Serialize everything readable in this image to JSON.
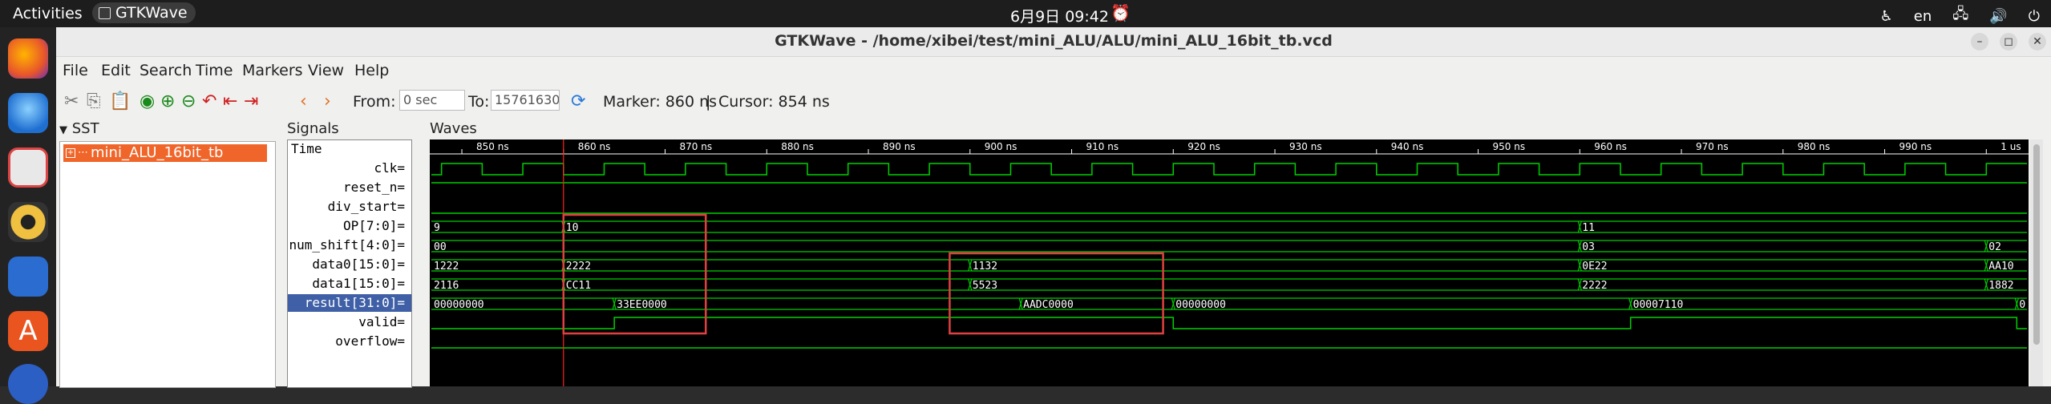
{
  "topbar": {
    "activities": "Activities",
    "app_name": "GTKWave",
    "clock": "6月9日  09:42",
    "lang": "en"
  },
  "window": {
    "title": "GTKWave - /home/xibei/test/mini_ALU/ALU/mini_ALU_16bit_tb.vcd"
  },
  "menu": [
    "File",
    "Edit",
    "Search",
    "Time",
    "Markers",
    "View",
    "Help"
  ],
  "toolbar": {
    "from_label": "From:",
    "from_value": "0 sec",
    "to_label": "To:",
    "to_value": "15761630",
    "marker_text": "Marker: 860 ns",
    "sep": "|",
    "cursor_text": "Cursor: 854 ns"
  },
  "sst": {
    "header": "SST",
    "items": [
      {
        "label": "mini_ALU_16bit_tb",
        "marker": "+"
      }
    ]
  },
  "signals": {
    "header": "Signals",
    "time_label": "Time",
    "rows": [
      "clk=",
      "reset_n=",
      "div_start=",
      "OP[7:0]=",
      "num_shift[4:0]=",
      "data0[15:0]=",
      "data1[15:0]=",
      "result[31:0]=",
      "valid=",
      "overflow="
    ],
    "highlight_index": 7
  },
  "waves": {
    "header": "Waves",
    "time_range_ns": [
      847,
      1004
    ],
    "time_ticks": [
      {
        "t": 850,
        "label": "850 ns"
      },
      {
        "t": 860,
        "label": "860 ns"
      },
      {
        "t": 870,
        "label": "870 ns"
      },
      {
        "t": 880,
        "label": "880 ns"
      },
      {
        "t": 890,
        "label": "890 ns"
      },
      {
        "t": 900,
        "label": "900 ns"
      },
      {
        "t": 910,
        "label": "910 ns"
      },
      {
        "t": 920,
        "label": "920 ns"
      },
      {
        "t": 930,
        "label": "930 ns"
      },
      {
        "t": 940,
        "label": "940 ns"
      },
      {
        "t": 950,
        "label": "950 ns"
      },
      {
        "t": 960,
        "label": "960 ns"
      },
      {
        "t": 970,
        "label": "970 ns"
      },
      {
        "t": 980,
        "label": "980 ns"
      },
      {
        "t": 990,
        "label": "990 ns"
      },
      {
        "t": 1000,
        "label": "1 us"
      }
    ],
    "marker_ns": 860,
    "colors": {
      "trace": "#00d000",
      "marker": "#ff2020",
      "ruler": "#ffffff",
      "box": "#e04040"
    },
    "clk": {
      "period_ns": 8,
      "first_rise_ns": 856
    },
    "reset_n": {
      "value": 1
    },
    "div_start": {
      "value": 0
    },
    "buses": [
      {
        "row": 3,
        "name": "OP",
        "segments": [
          {
            "t": 847,
            "v": "9"
          },
          {
            "t": 860,
            "v": "10"
          },
          {
            "t": 960,
            "v": "11"
          }
        ]
      },
      {
        "row": 4,
        "name": "num_shift",
        "segments": [
          {
            "t": 847,
            "v": "00"
          },
          {
            "t": 960,
            "v": "03"
          },
          {
            "t": 1000,
            "v": "02"
          }
        ]
      },
      {
        "row": 5,
        "name": "data0",
        "segments": [
          {
            "t": 847,
            "v": "1222"
          },
          {
            "t": 860,
            "v": "2222"
          },
          {
            "t": 900,
            "v": "1132"
          },
          {
            "t": 960,
            "v": "0E22"
          },
          {
            "t": 1000,
            "v": "AA10"
          }
        ]
      },
      {
        "row": 6,
        "name": "data1",
        "segments": [
          {
            "t": 847,
            "v": "2116"
          },
          {
            "t": 860,
            "v": "CC11"
          },
          {
            "t": 900,
            "v": "5523"
          },
          {
            "t": 960,
            "v": "2222"
          },
          {
            "t": 1000,
            "v": "1882"
          }
        ]
      },
      {
        "row": 7,
        "name": "result",
        "segments": [
          {
            "t": 847,
            "v": "00000000"
          },
          {
            "t": 865,
            "v": "33EE0000"
          },
          {
            "t": 905,
            "v": "AADC0000"
          },
          {
            "t": 920,
            "v": "00000000"
          },
          {
            "t": 965,
            "v": "00007110"
          },
          {
            "t": 1003,
            "v": "0"
          }
        ]
      }
    ],
    "valid": [
      {
        "t": 847,
        "v": 0
      },
      {
        "t": 865,
        "v": 1
      },
      {
        "t": 920,
        "v": 0
      },
      {
        "t": 965,
        "v": 1
      },
      {
        "t": 1003,
        "v": 0
      }
    ],
    "overflow": {
      "value": 0
    },
    "highlight_boxes": [
      {
        "t0": 860,
        "t1": 874,
        "row0": 3,
        "row1": 8
      },
      {
        "t0": 898,
        "t1": 919,
        "row0": 5,
        "row1": 8
      }
    ]
  }
}
